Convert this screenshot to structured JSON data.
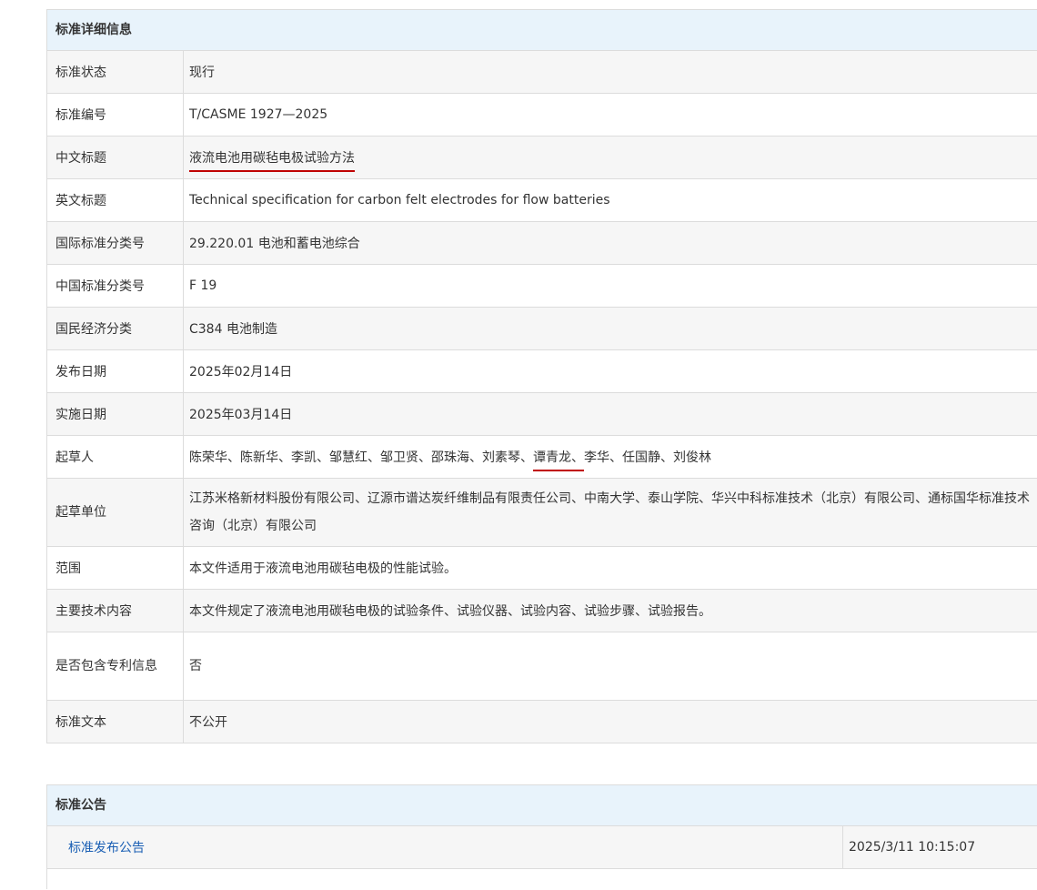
{
  "detail": {
    "header": "标准详细信息",
    "rows": [
      {
        "label": "标准状态",
        "value": "现行"
      },
      {
        "label": "标准编号",
        "value": "T/CASME 1927—2025"
      },
      {
        "label": "中文标题",
        "value": "液流电池用碳毡电极试验方法"
      },
      {
        "label": "英文标题",
        "value": "Technical specification for carbon felt electrodes for flow batteries"
      },
      {
        "label": "国际标准分类号",
        "value": "29.220.01 电池和蓄电池综合"
      },
      {
        "label": "中国标准分类号",
        "value": "F 19"
      },
      {
        "label": "国民经济分类",
        "value": "C384 电池制造"
      },
      {
        "label": "发布日期",
        "value": "2025年02月14日"
      },
      {
        "label": "实施日期",
        "value": "2025年03月14日"
      },
      {
        "label": "起草人",
        "value_before": "陈荣华、陈新华、李凯、邹慧红、邹卫贤、邵珠海、刘素琴、",
        "value_mark": "谭青龙、",
        "value_after": "李华、任国静、刘俊林"
      },
      {
        "label": "起草单位",
        "value": "江苏米格新材料股份有限公司、辽源市谱达炭纤维制品有限责任公司、中南大学、泰山学院、华兴中科标准技术（北京）有限公司、通标国华标准技术咨询（北京）有限公司"
      },
      {
        "label": "范围",
        "value": "本文件适用于液流电池用碳毡电极的性能试验。"
      },
      {
        "label": "主要技术内容",
        "value": "本文件规定了液流电池用碳毡电极的试验条件、试验仪器、试验内容、试验步骤、试验报告。"
      },
      {
        "label": "是否包含专利信息",
        "value": "否"
      },
      {
        "label": "标准文本",
        "value": "不公开"
      }
    ]
  },
  "notice": {
    "header": "标准公告",
    "items": [
      {
        "title": "标准发布公告",
        "datetime": "2025/3/11 10:15:07"
      }
    ]
  },
  "colors": {
    "header_bg": "#e8f3fb",
    "row_alt_bg": "#f6f6f6",
    "border": "#dcdcdc",
    "link": "#1a5fb4",
    "annotation_red": "#c00000"
  }
}
